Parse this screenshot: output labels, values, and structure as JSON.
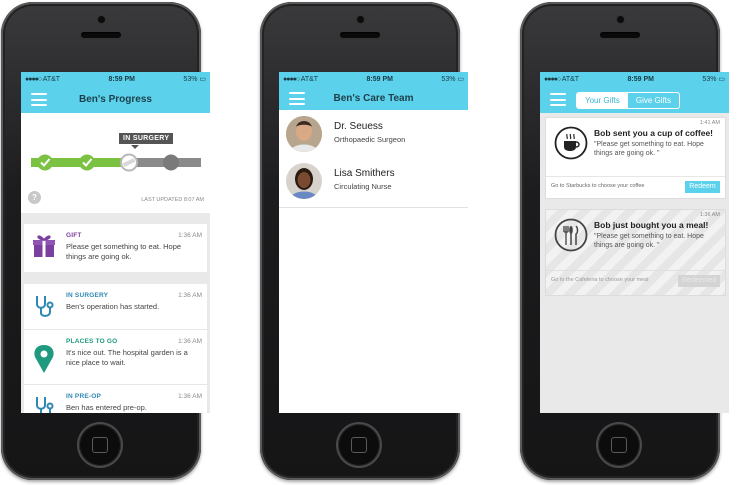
{
  "status": {
    "carrier": "AT&T",
    "time": "8:59 PM",
    "battery": "53%"
  },
  "screen1": {
    "title": "Ben's Progress",
    "stage_label": "IN SURGERY",
    "help": "?",
    "last_updated": "LAST UPDATED 8:07 AM",
    "progress": {
      "completed_steps": 2,
      "current_step": 3,
      "total_steps": 4
    },
    "gift": {
      "label": "GIFT",
      "time": "1:36 AM",
      "message": "Please get something to eat. Hope things are going ok."
    },
    "updates": [
      {
        "label": "IN SURGERY",
        "time": "1:36 AM",
        "message": "Ben's operation has started.",
        "icon": "stethoscope-icon"
      },
      {
        "label": "PLACES TO GO",
        "time": "1:36 AM",
        "message": "It's nice out. The hospital garden is a nice place to wait.",
        "icon": "map-pin-icon"
      },
      {
        "label": "IN PRE-OP",
        "time": "1:36 AM",
        "message": "Ben has entered pre-op.",
        "icon": "stethoscope-icon"
      }
    ]
  },
  "screen2": {
    "title": "Ben's Care Team",
    "members": [
      {
        "name": "Dr. Seuess",
        "role": "Orthopaedic Surgeon"
      },
      {
        "name": "Lisa Smithers",
        "role": "Circulating Nurse"
      }
    ]
  },
  "screen3": {
    "tabs": {
      "your_gifts": "Your Gifts",
      "give_gifts": "Give Gifts"
    },
    "gifts": [
      {
        "time": "1:41 AM",
        "title": "Bob sent you a cup of coffee!",
        "message": "\"Please get something to eat. Hope things are going ok. \"",
        "footer": "Go to Starbucks to choose your coffee",
        "button": "Redeem",
        "icon": "coffee-cup-icon",
        "active": true
      },
      {
        "time": "1:36 AM",
        "title": "Bob just bought you a meal!",
        "message": "\"Please get something to eat. Hope things are going ok. \"",
        "footer": "Go to the Cafeteria to choose your meal",
        "button": "Redeemed",
        "icon": "utensils-icon",
        "active": false
      }
    ]
  },
  "colors": {
    "accent": "#5cd1ec",
    "gift": "#7b3fa0",
    "surgery": "#2e88b4",
    "places": "#1f9a7e",
    "progress": "#7cc242"
  }
}
